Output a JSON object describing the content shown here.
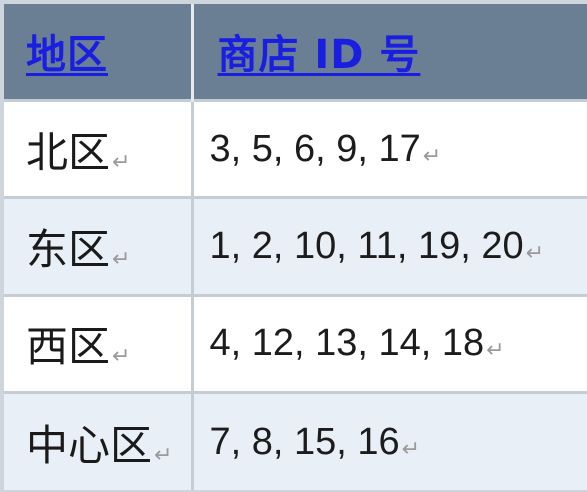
{
  "table": {
    "headers": {
      "region": "地区",
      "store_ids": "商店 ID 号"
    },
    "paragraph_mark": "↵",
    "rows": [
      {
        "region": "北区",
        "store_ids": "3, 5, 6, 9, 17"
      },
      {
        "region": "东区",
        "store_ids": "1, 2, 10, 11, 19, 20"
      },
      {
        "region": "西区",
        "store_ids": "4, 12, 13, 14, 18"
      },
      {
        "region": "中心区",
        "store_ids": "7, 8, 15, 16"
      }
    ]
  },
  "colors": {
    "header_bg": "#6b7f94",
    "header_link": "#1a1ee0",
    "row_alt_bg": "#e9eff6",
    "border": "#c4ccd4"
  }
}
